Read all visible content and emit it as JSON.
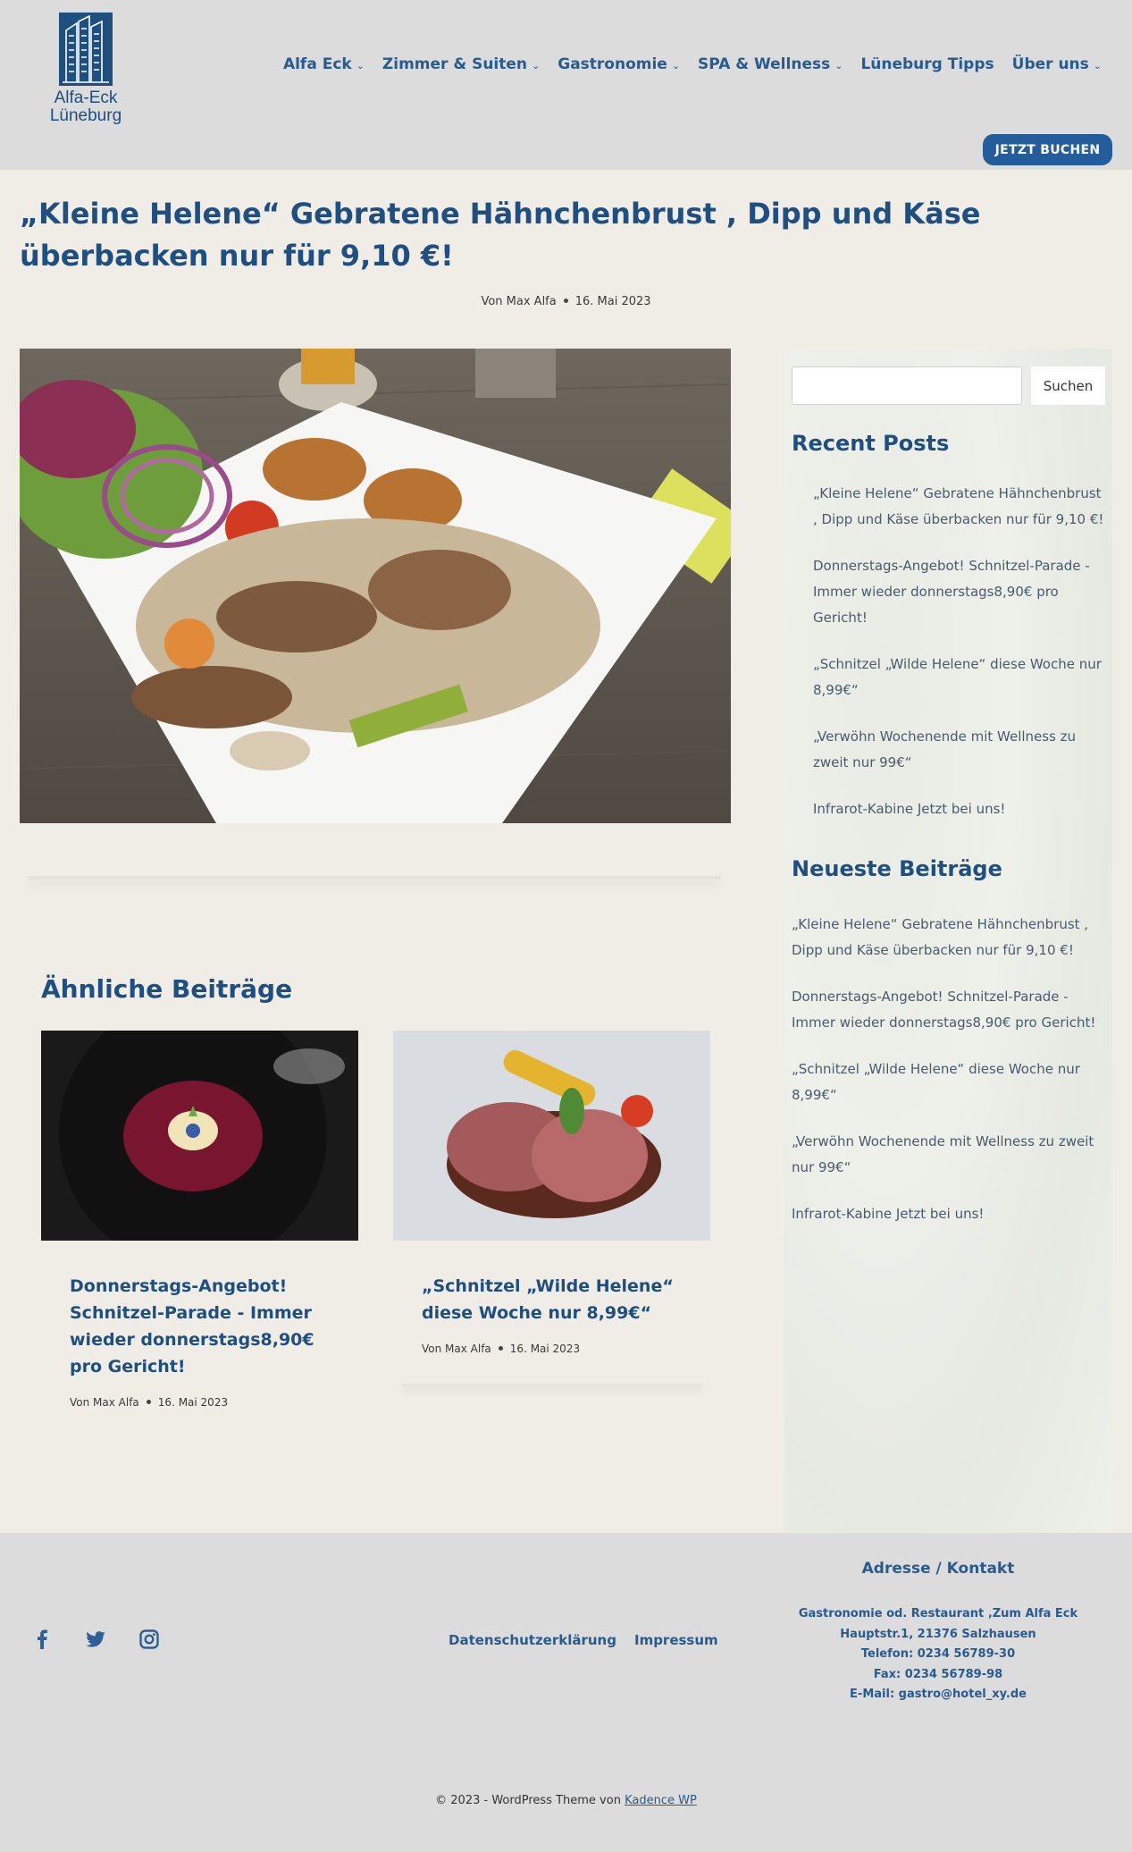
{
  "brand": {
    "line1": "Alfa-Eck",
    "line2": "Lüneburg",
    "logo_color": "#1d4f7f"
  },
  "nav": [
    {
      "label": "Alfa Eck",
      "dropdown": true
    },
    {
      "label": "Zimmer & Suiten",
      "dropdown": true
    },
    {
      "label": "Gastronomie",
      "dropdown": true
    },
    {
      "label": "SPA & Wellness",
      "dropdown": true
    },
    {
      "label": "Lüneburg Tipps",
      "dropdown": false
    },
    {
      "label": "Über uns",
      "dropdown": true
    }
  ],
  "book_button": "JETZT BUCHEN",
  "post": {
    "title": "„Kleine Helene“ Gebratene Hähnchenbrust , Dipp und Käse überbacken nur für 9,10 €!",
    "author": "Von Max Alfa",
    "date": "16. Mai 2023"
  },
  "related": {
    "heading": "Ähnliche Beiträge",
    "cards": [
      {
        "title": "Donnerstags-Angebot! Schnitzel-Parade - Immer wieder donnerstags8,90€ pro Gericht!",
        "author": "Von Max Alfa",
        "date": "16. Mai 2023"
      },
      {
        "title": "„Schnitzel „Wilde Helene“ diese Woche nur 8,99€“",
        "author": "Von Max Alfa",
        "date": "16. Mai 2023"
      }
    ]
  },
  "sidebar": {
    "search_button": "Suchen",
    "recent_heading": "Recent Posts",
    "recent": [
      "„Kleine Helene“ Gebratene Hähnchenbrust , Dipp und Käse überbacken nur für 9,10 €!",
      "Donnerstags-Angebot! Schnitzel-Parade - Immer wieder donnerstags8,90€ pro Gericht!",
      "„Schnitzel „Wilde Helene“ diese Woche nur 8,99€“",
      "„Verwöhn Wochenende mit Wellness zu zweit nur 99€“",
      "Infrarot-Kabine Jetzt bei uns!"
    ],
    "newest_heading": "Neueste Beiträge",
    "newest": [
      "„Kleine Helene“ Gebratene Hähnchenbrust , Dipp und Käse überbacken nur für 9,10 €!",
      "Donnerstags-Angebot! Schnitzel-Parade - Immer wieder donnerstags8,90€ pro Gericht!",
      "„Schnitzel „Wilde Helene“ diese Woche nur 8,99€“",
      "„Verwöhn Wochenende mit Wellness zu zweit nur 99€“",
      "Infrarot-Kabine Jetzt bei uns!"
    ]
  },
  "footer": {
    "social": [
      "facebook-icon",
      "twitter-icon",
      "instagram-icon"
    ],
    "links": [
      "Datenschutzerklärung",
      "Impressum"
    ],
    "address_heading": "Adresse / Kontakt",
    "address_lines": [
      "Gastronomie od. Restaurant ‚Zum Alfa Eck",
      "Hauptstr.1, 21376 Salzhausen",
      "Telefon: 0234 56789-30",
      "Fax: 0234 56789-98",
      "E-Mail: gastro@hotel_xy.de"
    ],
    "copyright": "© 2023 - WordPress Theme von",
    "theme_link": "Kadence WP"
  },
  "colors": {
    "accent": "#1f4e80",
    "button": "#245d9b",
    "header_bg": "#dcdcdc",
    "page_bg": "#efede6"
  }
}
